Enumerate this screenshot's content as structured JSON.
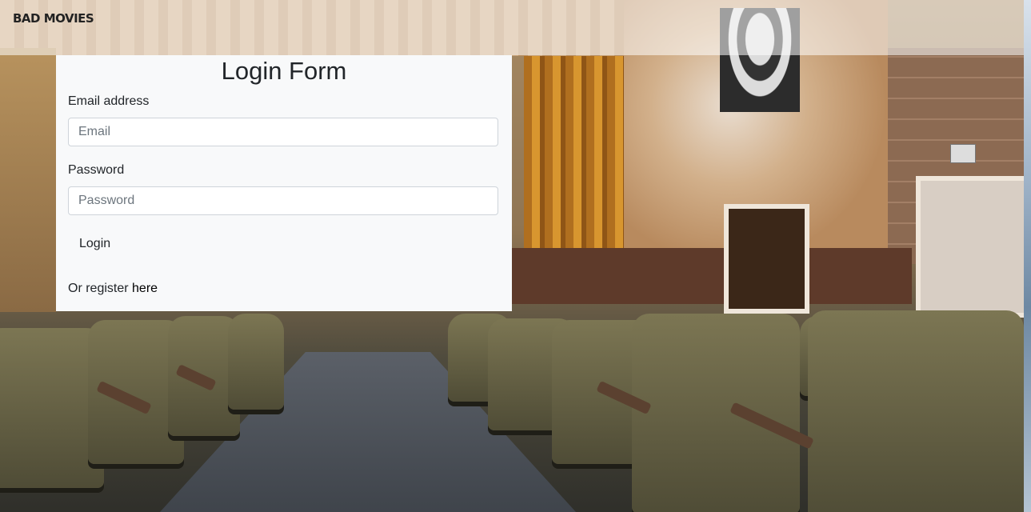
{
  "navbar": {
    "brand": "BAD MOVIES"
  },
  "login_form": {
    "title": "Login Form",
    "email_label": "Email address",
    "email_placeholder": "Email",
    "email_value": "",
    "password_label": "Password",
    "password_placeholder": "Password",
    "password_value": "",
    "submit_label": "Login",
    "register_prefix": "Or register ",
    "register_link": "here"
  },
  "background": {
    "description_icon": "abandoned-theater-image"
  }
}
